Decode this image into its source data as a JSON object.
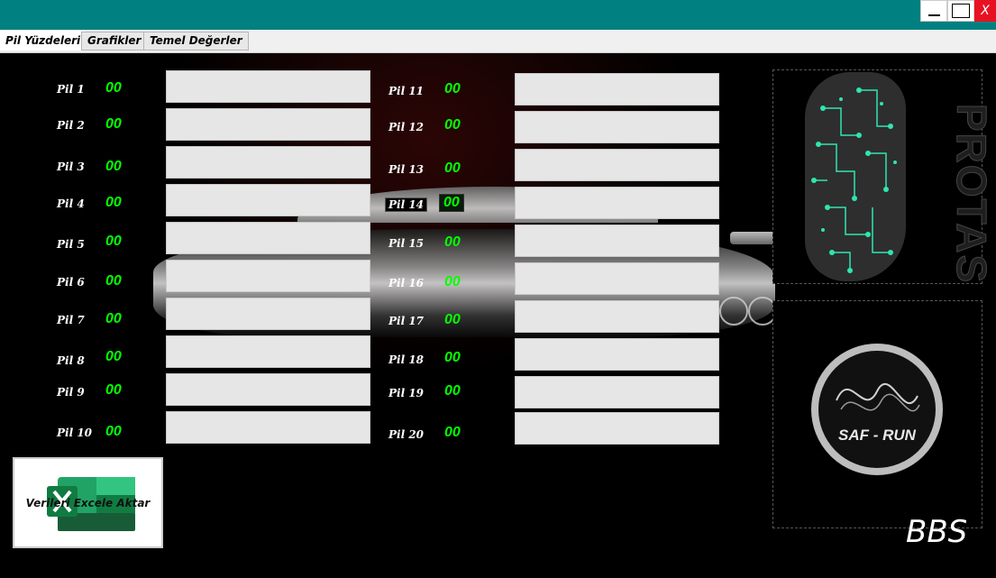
{
  "window": {
    "minimize_icon": "minimize-icon",
    "maximize_icon": "maximize-icon",
    "close_label": "X",
    "title_bar_color": "#008080"
  },
  "tabs": [
    {
      "label": "Pil Yüzdeleri",
      "active": true
    },
    {
      "label": "Grafikler",
      "active": false
    },
    {
      "label": "Temel Değerler",
      "active": false
    }
  ],
  "batteries_left": [
    {
      "label": "Pil 1",
      "value": "00"
    },
    {
      "label": "Pil 2",
      "value": "00"
    },
    {
      "label": "Pil 3",
      "value": "00"
    },
    {
      "label": "Pil 4",
      "value": "00"
    },
    {
      "label": "Pil 5",
      "value": "00"
    },
    {
      "label": "Pil 6",
      "value": "00"
    },
    {
      "label": "Pil 7",
      "value": "00"
    },
    {
      "label": "Pil 8",
      "value": "00"
    },
    {
      "label": "Pil 9",
      "value": "00"
    },
    {
      "label": "Pil 10",
      "value": "00"
    }
  ],
  "batteries_right": [
    {
      "label": "Pil 11",
      "value": "00"
    },
    {
      "label": "Pil 12",
      "value": "00"
    },
    {
      "label": "Pil 13",
      "value": "00"
    },
    {
      "label": "Pil 14",
      "value": "00"
    },
    {
      "label": "Pil 15",
      "value": "00"
    },
    {
      "label": "Pil 16",
      "value": "00"
    },
    {
      "label": "Pil 17",
      "value": "00"
    },
    {
      "label": "Pil 18",
      "value": "00"
    },
    {
      "label": "Pil 19",
      "value": "00"
    },
    {
      "label": "Pil 20",
      "value": "00"
    }
  ],
  "excel_button": {
    "label": "Verileri Excele Aktar",
    "icon": "excel-icon"
  },
  "logos": {
    "protas": {
      "text": "PROTAS",
      "icon": "circuit-brain-icon",
      "accent": "#2ee6b0"
    },
    "safrun": {
      "text": "SAF - RUN"
    }
  },
  "footer": {
    "bbs": "BBS"
  },
  "colors": {
    "value_green": "#00ff00",
    "box_gray": "#e6e6e6",
    "background": "#000000"
  }
}
